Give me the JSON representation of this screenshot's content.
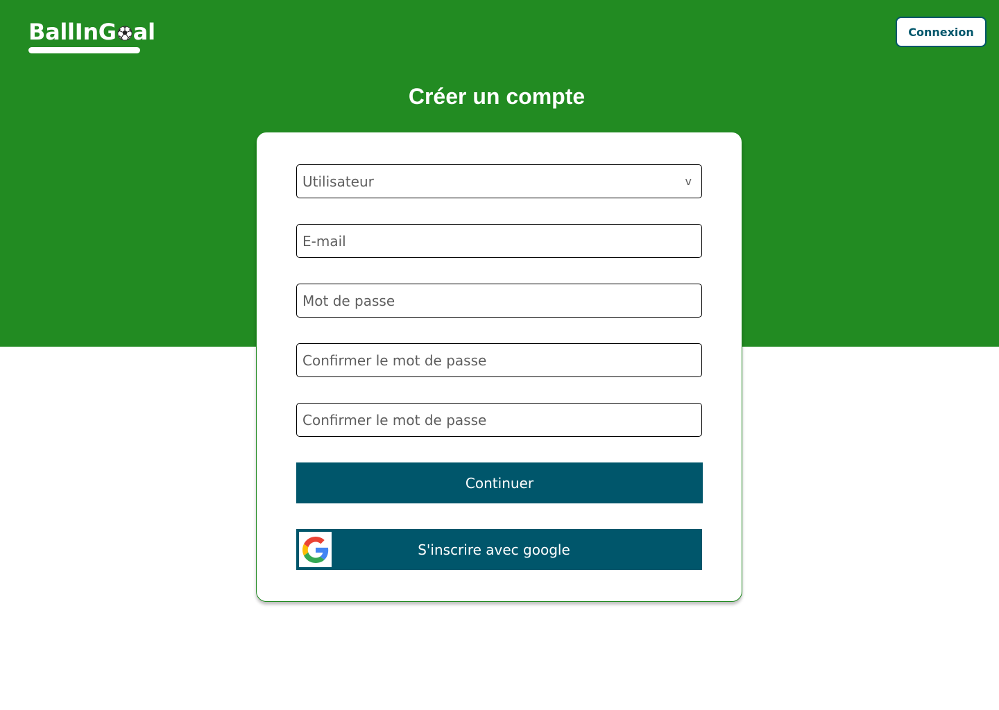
{
  "header": {
    "logo_prefix": "BallInG",
    "logo_suffix": "al",
    "login_label": "Connexion"
  },
  "title": "Créer un compte",
  "form": {
    "user_type": {
      "value": "Utilisateur",
      "chevron": "v"
    },
    "email": {
      "placeholder": "E-mail"
    },
    "password": {
      "placeholder": "Mot de passe"
    },
    "confirm_password": {
      "placeholder": "Confirmer le mot de passe"
    },
    "confirm_password_2": {
      "placeholder": "Confirmer le mot de passe"
    },
    "continue_label": "Continuer",
    "google_label": "S'inscrire avec google"
  },
  "colors": {
    "hero": "#228b22",
    "primary": "#00566b",
    "card_border": "#228b22"
  },
  "icons": {
    "logo_ball": "soccer-ball-icon",
    "google": "google-g-icon"
  }
}
